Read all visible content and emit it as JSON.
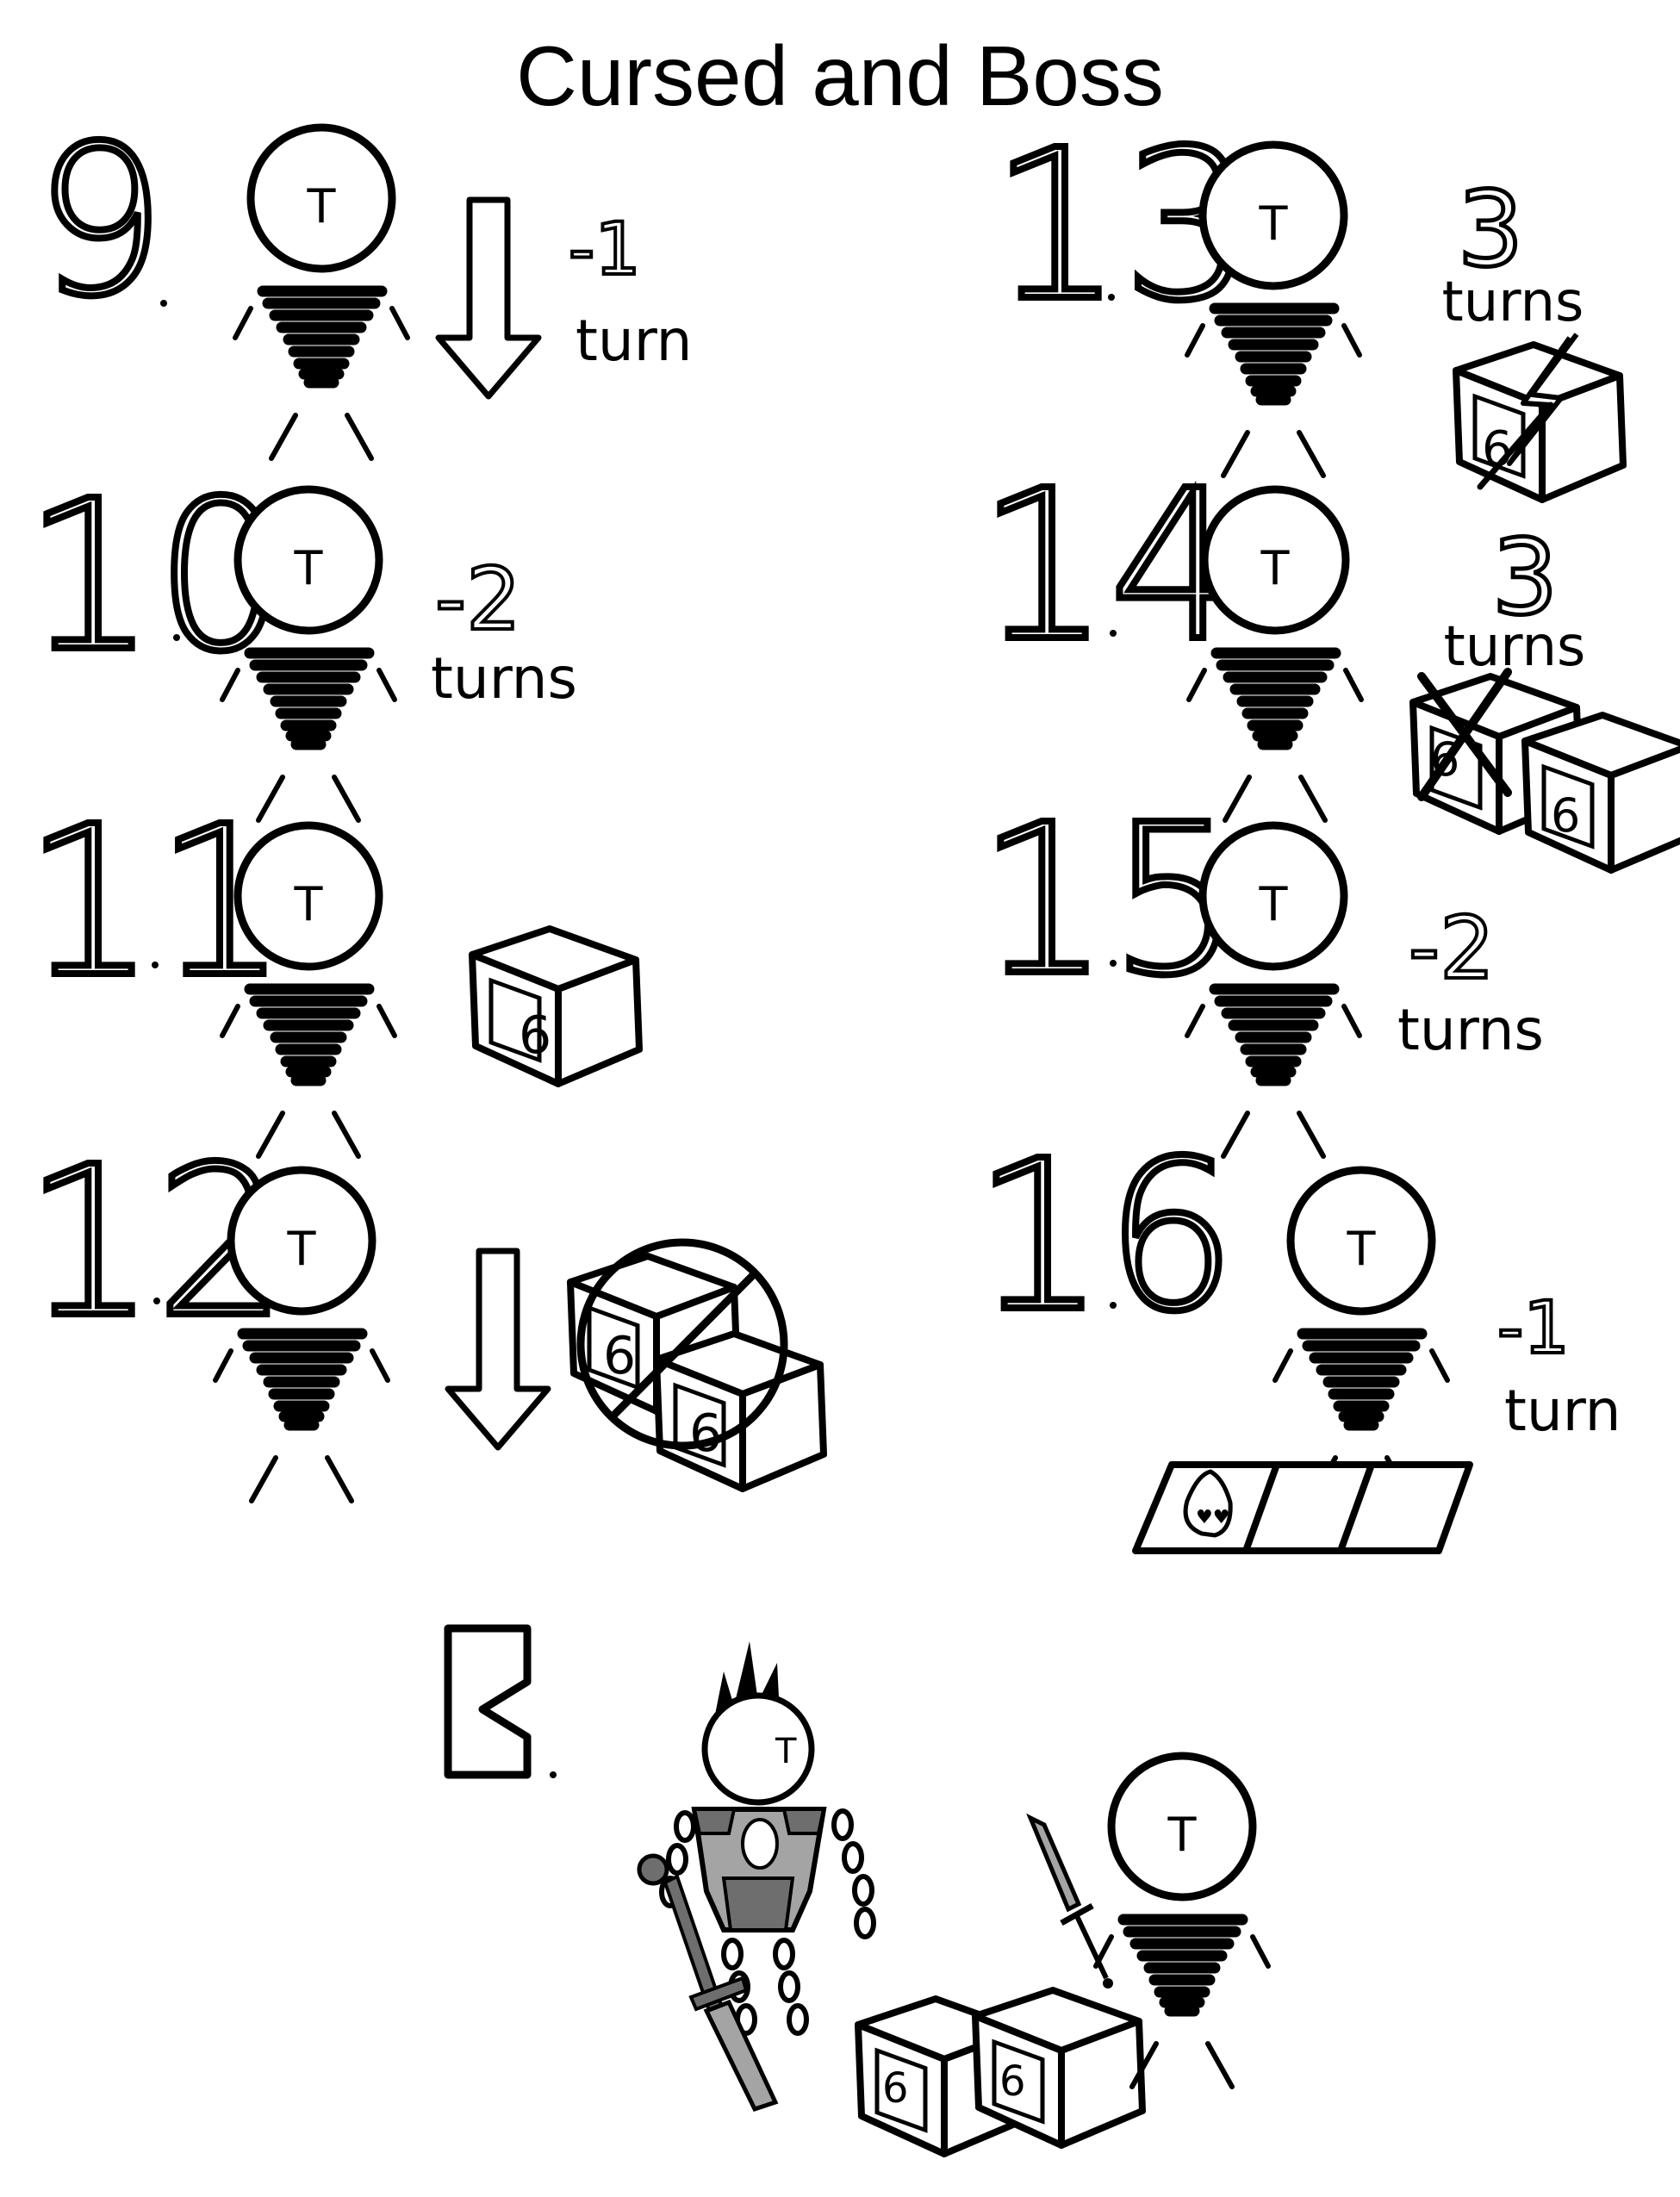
{
  "title": "Cursed and Boss",
  "token_letter": "T",
  "die_face": "6",
  "cards": [
    {
      "number": "9",
      "line1": "-1",
      "line2": "turn",
      "picture": "move-down-arrow"
    },
    {
      "number": "10",
      "line1": "-2",
      "line2": "turns",
      "picture": "none"
    },
    {
      "number": "11",
      "picture": "die"
    },
    {
      "number": "12",
      "picture": "move-down-arrow-two-dice-crossed"
    },
    {
      "number": "13",
      "line1": "3",
      "line2": "turns",
      "picture": "die-struck-by-lightning"
    },
    {
      "number": "14",
      "line1": "3",
      "line2": "turns",
      "picture": "die-crossed-and-die"
    },
    {
      "number": "15",
      "line1": "-2",
      "line2": "turns",
      "picture": "none"
    },
    {
      "number": "16",
      "line1": "-1",
      "line2": "turn",
      "picture": "board-track-with-egg"
    }
  ],
  "boss": {
    "number": "B",
    "picture": "armored-boss-with-sword-vs-token-with-sword-two-dice"
  },
  "colors": {
    "ink": "#000000",
    "armor_dark": "#6e6e6e",
    "armor_mid": "#a4a4a4",
    "armor_light": "#d8d8d8",
    "paper": "#ffffff"
  }
}
